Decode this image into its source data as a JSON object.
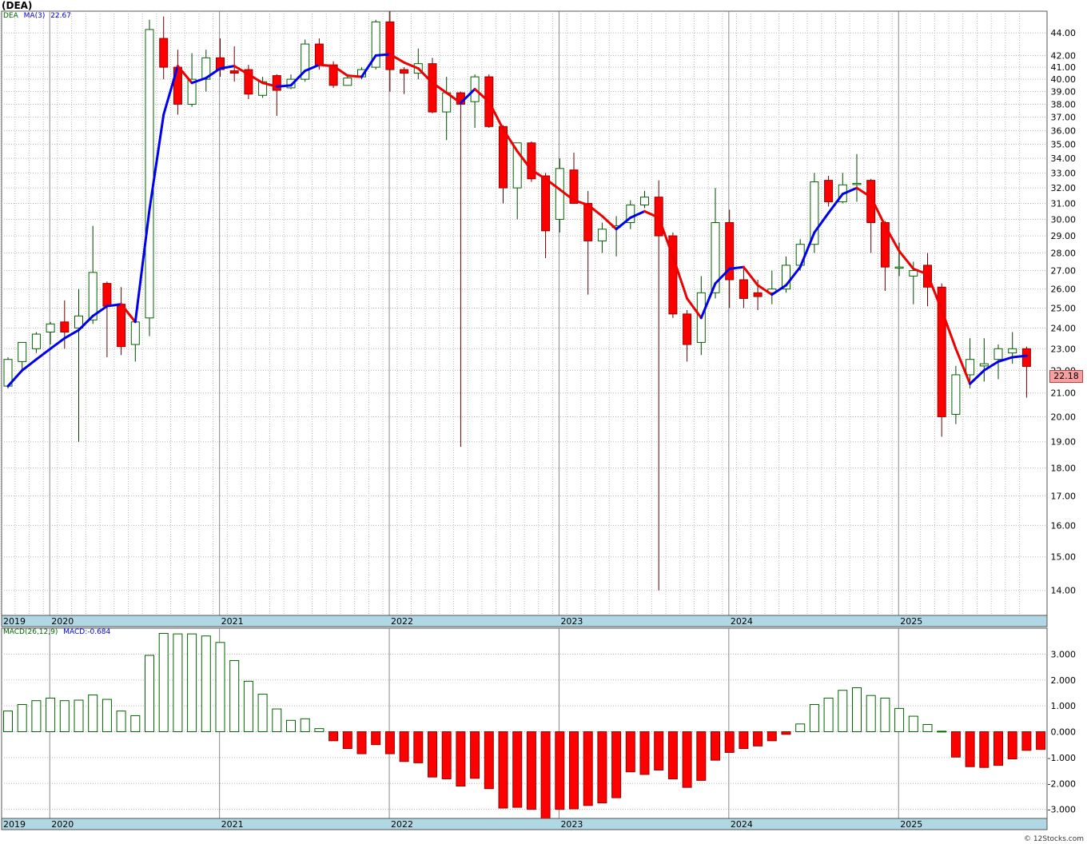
{
  "header": {
    "ticker": "(DEA)",
    "symbol": "DEA",
    "ma_label": "MA(3)",
    "ma_value": "22.67"
  },
  "macd_header": {
    "label": "MACD(26,12,9)",
    "value_label": "MACD:-0.684"
  },
  "last_price": "22.18",
  "credit": "© 12Stocks.com",
  "colors": {
    "up": "#006400",
    "down": "#ff0000",
    "ma_up": "#0000ee",
    "ma_down": "#ee0000",
    "grid": "#b8b8b8",
    "band": "#b0d8e4"
  },
  "chart_data": [
    {
      "type": "candlestick",
      "scale": "log",
      "ylim": [
        13.3,
        46.0
      ],
      "yticks": [
        14,
        15,
        16,
        17,
        18,
        19,
        20,
        21,
        22,
        23,
        24,
        25,
        26,
        27,
        28,
        29,
        30,
        31,
        32,
        33,
        34,
        35,
        36,
        37,
        38,
        39,
        40,
        41,
        42,
        44
      ],
      "ytick_labels": [
        "14.00",
        "15.00",
        "16.00",
        "17.00",
        "18.00",
        "19.00",
        "20.00",
        "21.00",
        "22.00",
        "23.00",
        "24.00",
        "25.00",
        "26.00",
        "27.00",
        "28.00",
        "29.00",
        "30.00",
        "31.00",
        "32.00",
        "33.00",
        "34.00",
        "35.00",
        "36.00",
        "37.00",
        "38.00",
        "39.00",
        "40.00",
        "41.00",
        "42.00",
        "44.00"
      ],
      "x_labels": [
        "2019",
        "2020",
        "2021",
        "2022",
        "2023",
        "2024",
        "2025"
      ],
      "x_label_bar_index": [
        -1,
        3,
        15,
        27,
        39,
        51,
        63
      ],
      "grid": true,
      "candles": [
        {
          "o": 21.3,
          "h": 22.6,
          "l": 21.2,
          "c": 22.5
        },
        {
          "o": 22.4,
          "h": 23.3,
          "l": 22.0,
          "c": 23.3
        },
        {
          "o": 23.0,
          "h": 23.8,
          "l": 22.8,
          "c": 23.7
        },
        {
          "o": 23.8,
          "h": 24.3,
          "l": 23.2,
          "c": 24.2
        },
        {
          "o": 24.3,
          "h": 25.4,
          "l": 23.0,
          "c": 23.8
        },
        {
          "o": 24.0,
          "h": 26.0,
          "l": 19.0,
          "c": 24.6
        },
        {
          "o": 24.4,
          "h": 29.6,
          "l": 24.2,
          "c": 26.9
        },
        {
          "o": 26.3,
          "h": 26.4,
          "l": 22.6,
          "c": 25.1
        },
        {
          "o": 25.2,
          "h": 26.1,
          "l": 22.7,
          "c": 23.1
        },
        {
          "o": 23.2,
          "h": 24.4,
          "l": 22.4,
          "c": 24.3
        },
        {
          "o": 24.5,
          "h": 45.2,
          "l": 23.6,
          "c": 44.3
        },
        {
          "o": 43.5,
          "h": 45.5,
          "l": 40.0,
          "c": 41.0
        },
        {
          "o": 41.0,
          "h": 42.5,
          "l": 37.2,
          "c": 38.0
        },
        {
          "o": 38.0,
          "h": 42.2,
          "l": 37.8,
          "c": 40.0
        },
        {
          "o": 40.0,
          "h": 42.5,
          "l": 39.0,
          "c": 41.8
        },
        {
          "o": 41.8,
          "h": 43.5,
          "l": 40.2,
          "c": 40.8
        },
        {
          "o": 40.7,
          "h": 42.8,
          "l": 39.8,
          "c": 40.5
        },
        {
          "o": 40.8,
          "h": 41.2,
          "l": 38.4,
          "c": 38.8
        },
        {
          "o": 38.7,
          "h": 40.2,
          "l": 38.5,
          "c": 39.8
        },
        {
          "o": 40.3,
          "h": 40.4,
          "l": 37.1,
          "c": 39.1
        },
        {
          "o": 39.3,
          "h": 40.4,
          "l": 39.2,
          "c": 40.0
        },
        {
          "o": 40.0,
          "h": 43.4,
          "l": 39.8,
          "c": 43.0
        },
        {
          "o": 43.0,
          "h": 43.5,
          "l": 40.8,
          "c": 41.2
        },
        {
          "o": 41.2,
          "h": 41.5,
          "l": 39.3,
          "c": 39.5
        },
        {
          "o": 39.5,
          "h": 40.2,
          "l": 39.5,
          "c": 40.1
        },
        {
          "o": 40.2,
          "h": 41.0,
          "l": 40.0,
          "c": 40.8
        },
        {
          "o": 41.0,
          "h": 45.2,
          "l": 40.8,
          "c": 45.0
        },
        {
          "o": 45.0,
          "h": 46.0,
          "l": 39.0,
          "c": 40.8
        },
        {
          "o": 40.8,
          "h": 41.0,
          "l": 38.8,
          "c": 40.5
        },
        {
          "o": 40.5,
          "h": 42.6,
          "l": 40.0,
          "c": 41.3
        },
        {
          "o": 41.3,
          "h": 41.8,
          "l": 37.3,
          "c": 37.4
        },
        {
          "o": 37.4,
          "h": 40.2,
          "l": 35.3,
          "c": 38.9
        },
        {
          "o": 38.9,
          "h": 39.0,
          "l": 18.8,
          "c": 38.0
        },
        {
          "o": 38.2,
          "h": 40.4,
          "l": 36.2,
          "c": 40.2
        },
        {
          "o": 40.2,
          "h": 40.4,
          "l": 36.2,
          "c": 36.3
        },
        {
          "o": 36.3,
          "h": 36.4,
          "l": 31.0,
          "c": 32.0
        },
        {
          "o": 32.0,
          "h": 35.1,
          "l": 30.0,
          "c": 35.1
        },
        {
          "o": 35.1,
          "h": 35.2,
          "l": 32.4,
          "c": 32.6
        },
        {
          "o": 32.8,
          "h": 33.0,
          "l": 27.7,
          "c": 29.3
        },
        {
          "o": 30.0,
          "h": 34.0,
          "l": 29.2,
          "c": 33.3
        },
        {
          "o": 33.2,
          "h": 34.4,
          "l": 31.0,
          "c": 31.0
        },
        {
          "o": 31.0,
          "h": 31.8,
          "l": 25.7,
          "c": 28.7
        },
        {
          "o": 28.7,
          "h": 29.8,
          "l": 28.0,
          "c": 29.4
        },
        {
          "o": 29.5,
          "h": 30.2,
          "l": 27.8,
          "c": 29.6
        },
        {
          "o": 29.8,
          "h": 31.2,
          "l": 29.4,
          "c": 30.9
        },
        {
          "o": 30.9,
          "h": 31.8,
          "l": 30.7,
          "c": 31.4
        },
        {
          "o": 31.4,
          "h": 32.5,
          "l": 14.0,
          "c": 29.0
        },
        {
          "o": 29.0,
          "h": 29.2,
          "l": 24.5,
          "c": 24.7
        },
        {
          "o": 24.7,
          "h": 24.9,
          "l": 22.4,
          "c": 23.2
        },
        {
          "o": 23.3,
          "h": 26.7,
          "l": 22.7,
          "c": 25.8
        },
        {
          "o": 25.8,
          "h": 32.0,
          "l": 25.5,
          "c": 29.8
        },
        {
          "o": 29.8,
          "h": 30.6,
          "l": 25.0,
          "c": 26.5
        },
        {
          "o": 26.5,
          "h": 27.2,
          "l": 25.0,
          "c": 25.5
        },
        {
          "o": 25.8,
          "h": 26.5,
          "l": 24.9,
          "c": 25.6
        },
        {
          "o": 25.8,
          "h": 27.0,
          "l": 25.2,
          "c": 26.0
        },
        {
          "o": 26.0,
          "h": 27.8,
          "l": 25.8,
          "c": 27.3
        },
        {
          "o": 27.3,
          "h": 28.8,
          "l": 27.0,
          "c": 28.5
        },
        {
          "o": 28.5,
          "h": 33.0,
          "l": 28.0,
          "c": 32.4
        },
        {
          "o": 32.5,
          "h": 32.8,
          "l": 30.8,
          "c": 31.1
        },
        {
          "o": 31.1,
          "h": 33.0,
          "l": 31.0,
          "c": 32.2
        },
        {
          "o": 32.3,
          "h": 34.3,
          "l": 31.1,
          "c": 32.3
        },
        {
          "o": 32.5,
          "h": 32.6,
          "l": 28.0,
          "c": 29.8
        },
        {
          "o": 29.8,
          "h": 29.9,
          "l": 25.9,
          "c": 27.2
        },
        {
          "o": 27.2,
          "h": 28.6,
          "l": 26.7,
          "c": 27.2
        },
        {
          "o": 26.7,
          "h": 27.5,
          "l": 25.2,
          "c": 27.0
        },
        {
          "o": 27.3,
          "h": 28.0,
          "l": 25.1,
          "c": 26.1
        },
        {
          "o": 26.1,
          "h": 26.3,
          "l": 19.2,
          "c": 20.0
        },
        {
          "o": 20.1,
          "h": 22.2,
          "l": 19.7,
          "c": 21.8
        },
        {
          "o": 21.8,
          "h": 23.5,
          "l": 21.2,
          "c": 22.5
        },
        {
          "o": 22.2,
          "h": 23.5,
          "l": 21.5,
          "c": 22.3
        },
        {
          "o": 22.5,
          "h": 23.2,
          "l": 21.6,
          "c": 23.0
        },
        {
          "o": 22.8,
          "h": 23.8,
          "l": 22.3,
          "c": 23.0
        },
        {
          "o": 23.0,
          "h": 23.1,
          "l": 20.8,
          "c": 22.18
        }
      ],
      "ma3": [
        21.3,
        22.0,
        22.5,
        23.0,
        23.5,
        23.9,
        24.6,
        25.1,
        25.2,
        24.3,
        30.6,
        37.2,
        41.1,
        39.7,
        40.1,
        40.9,
        41.1,
        40.4,
        39.7,
        39.4,
        39.5,
        40.7,
        41.2,
        41.1,
        40.3,
        40.2,
        42.0,
        42.1,
        41.4,
        40.9,
        39.7,
        38.9,
        38.1,
        39.2,
        38.2,
        36.1,
        34.5,
        33.2,
        32.6,
        31.9,
        31.2,
        30.9,
        30.2,
        29.4,
        30.1,
        30.5,
        30.1,
        27.8,
        25.5,
        24.5,
        26.3,
        27.1,
        27.2,
        26.2,
        25.7,
        26.2,
        27.2,
        29.2,
        30.4,
        31.6,
        32.0,
        31.4,
        29.6,
        28.1,
        27.1,
        26.8,
        24.9,
        23.0,
        21.4,
        22.0,
        22.4,
        22.6,
        22.67
      ]
    },
    {
      "type": "bar",
      "title": "MACD(26,12,9)",
      "ylim": [
        -3.35,
        4.0
      ],
      "yticks": [
        3,
        2,
        1,
        0,
        -1,
        -2,
        -3
      ],
      "ytick_labels": [
        "3.000",
        "2.000",
        "1.000",
        "0.000",
        "-1.000",
        "-2.000",
        "-3.000"
      ],
      "x_labels": [
        "2019",
        "2020",
        "2021",
        "2022",
        "2023",
        "2024",
        "2025"
      ],
      "values": [
        0.8,
        1.05,
        1.2,
        1.3,
        1.2,
        1.22,
        1.42,
        1.25,
        0.8,
        0.62,
        2.95,
        3.8,
        3.78,
        3.78,
        3.7,
        3.45,
        2.75,
        1.95,
        1.45,
        0.88,
        0.44,
        0.5,
        0.12,
        -0.35,
        -0.65,
        -0.85,
        -0.5,
        -0.85,
        -1.15,
        -1.2,
        -1.75,
        -1.82,
        -2.1,
        -1.8,
        -2.2,
        -2.95,
        -2.92,
        -3.0,
        -3.4,
        -3.0,
        -2.98,
        -2.85,
        -2.75,
        -2.55,
        -1.55,
        -1.65,
        -1.48,
        -1.82,
        -2.15,
        -1.88,
        -1.1,
        -0.8,
        -0.65,
        -0.55,
        -0.35,
        -0.1,
        0.3,
        1.05,
        1.3,
        1.6,
        1.7,
        1.4,
        1.3,
        0.9,
        0.6,
        0.28,
        0.02,
        -0.98,
        -1.35,
        -1.38,
        -1.3,
        -1.05,
        -0.72,
        -0.684
      ]
    }
  ]
}
